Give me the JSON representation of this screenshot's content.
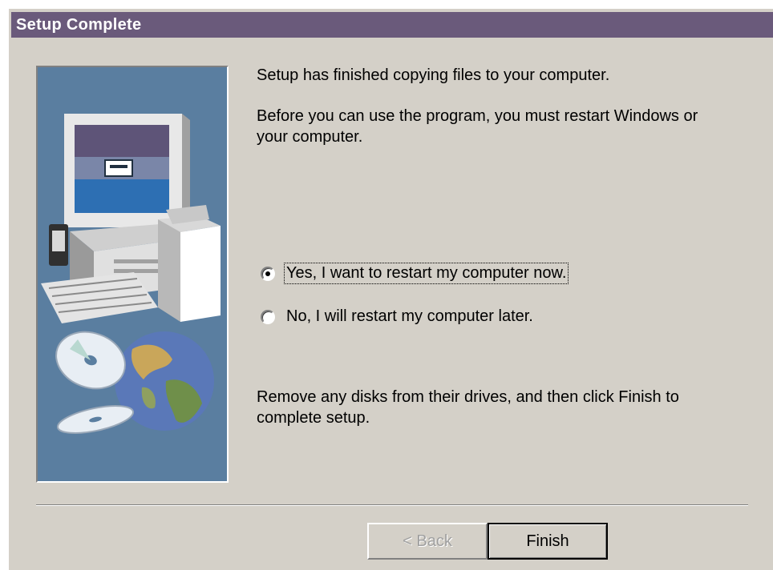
{
  "window": {
    "title": "Setup Complete"
  },
  "content": {
    "line1": "Setup has finished copying files to your computer.",
    "line2a": "Before you can use the program, you must restart Windows or",
    "line2b": "your computer.",
    "option_yes": "Yes, I want to restart my computer now.",
    "option_no": "No, I will restart my computer later.",
    "selected_option": "yes",
    "line3a": "Remove any disks from their drives, and then click Finish to",
    "line3b": "complete setup."
  },
  "buttons": {
    "back": "< Back",
    "finish": "Finish"
  },
  "colors": {
    "titlebar": "#6a5a7b",
    "dialog": "#d4d0c8",
    "art_bg": "#5a7ea0"
  }
}
